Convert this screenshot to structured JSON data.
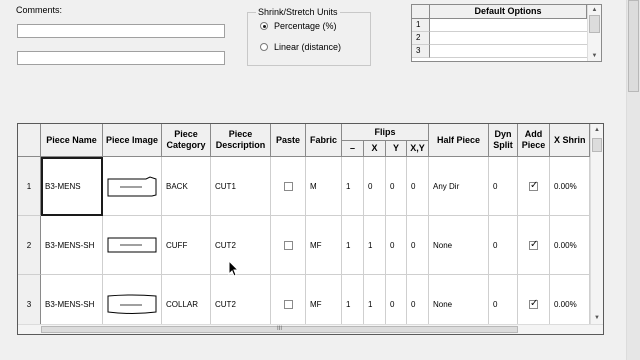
{
  "comments": {
    "label": "Comments:",
    "line1": "",
    "line2": ""
  },
  "shrink": {
    "title": "Shrink/Stretch Units",
    "options": [
      {
        "label": "Percentage (%)",
        "selected": true
      },
      {
        "label": "Linear (distance)",
        "selected": false
      }
    ]
  },
  "default_options": {
    "header": "Default Options",
    "rows": [
      "1",
      "2",
      "3"
    ]
  },
  "grid": {
    "headers": {
      "piece_name": "Piece Name",
      "piece_image": "Piece Image",
      "piece_category": "Piece Category",
      "piece_description": "Piece Description",
      "paste": "Paste",
      "fabric": "Fabric",
      "flips": "Flips",
      "flip_dash": "–",
      "flip_x": "X",
      "flip_y": "Y",
      "flip_xy": "X,Y",
      "half_piece": "Half Piece",
      "dyn_split": "Dyn Split",
      "add_piece": "Add Piece",
      "x_shrink": "X Shrin"
    },
    "rows": [
      {
        "num": "1",
        "name": "B3-MENS",
        "category": "BACK",
        "description": "CUT1",
        "paste": false,
        "fabric": "M",
        "flip_dash": "1",
        "flip_x": "0",
        "flip_y": "0",
        "flip_xy": "0",
        "half": "Any Dir",
        "dyn": "0",
        "add": true,
        "xshrink": "0.00%"
      },
      {
        "num": "2",
        "name": "B3-MENS-SH",
        "category": "CUFF",
        "description": "CUT2",
        "paste": false,
        "fabric": "MF",
        "flip_dash": "1",
        "flip_x": "1",
        "flip_y": "0",
        "flip_xy": "0",
        "half": "None",
        "dyn": "0",
        "add": true,
        "xshrink": "0.00%"
      },
      {
        "num": "3",
        "name": "B3-MENS-SH",
        "category": "COLLAR",
        "description": "CUT2",
        "paste": false,
        "fabric": "MF",
        "flip_dash": "1",
        "flip_x": "1",
        "flip_y": "0",
        "flip_xy": "0",
        "half": "None",
        "dyn": "0",
        "add": true,
        "xshrink": "0.00%"
      }
    ],
    "scroll_grip": "III"
  }
}
